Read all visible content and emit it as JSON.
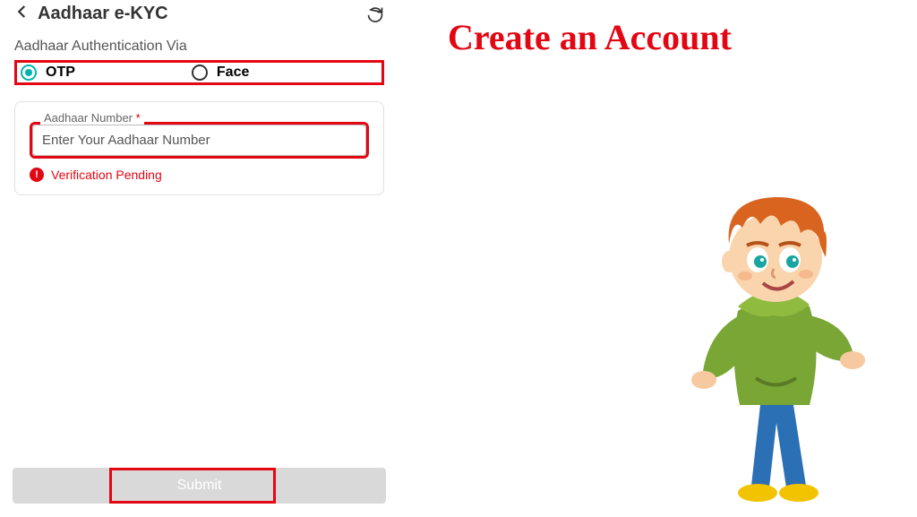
{
  "header": {
    "title": "Aadhaar e-KYC"
  },
  "auth": {
    "section_label": "Aadhaar Authentication Via",
    "opt_otp": "OTP",
    "opt_face": "Face"
  },
  "field": {
    "legend": "Aadhaar Number",
    "star": "*",
    "placeholder": "Enter Your Aadhaar Number",
    "verification_text": "Verification Pending",
    "verification_mark": "!"
  },
  "submit": {
    "label": "Submit"
  },
  "promo": {
    "heading": "Create an Account"
  }
}
